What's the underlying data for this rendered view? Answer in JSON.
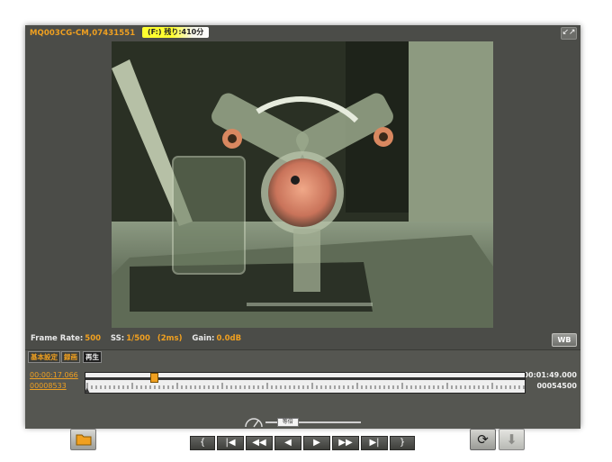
{
  "header": {
    "camera_id": "MQ003CG-CM,07431551",
    "remaining_label": "(F:) 残り:410分"
  },
  "info": {
    "frame_rate_label": "Frame Rate:",
    "frame_rate_value": "500",
    "ss_label": "SS:",
    "ss_value": "1/500",
    "ss_ms": "(2ms)",
    "gain_label": "Gain:",
    "gain_value": "0.0dB",
    "wb_label": "WB"
  },
  "tabs": [
    {
      "label": "基本設定"
    },
    {
      "label": "録画"
    },
    {
      "label": "再生"
    }
  ],
  "playback": {
    "current_time": "00:00:17.066",
    "current_frame": "00008533",
    "total_time": "00:01:49.000",
    "total_frames": "00054500",
    "position_fraction": 0.1566,
    "speed_label": "等倍",
    "speed_fraction": 0.12
  },
  "controls": {
    "mark_in": "{",
    "skip_start": "|◀",
    "rewind": "◀◀",
    "step_back": "◀",
    "play": "▶",
    "fast_forward": "▶▶",
    "skip_end": "▶|",
    "mark_out": "}"
  },
  "colors": {
    "accent": "#f0a020",
    "panel": "#4b4c48"
  }
}
